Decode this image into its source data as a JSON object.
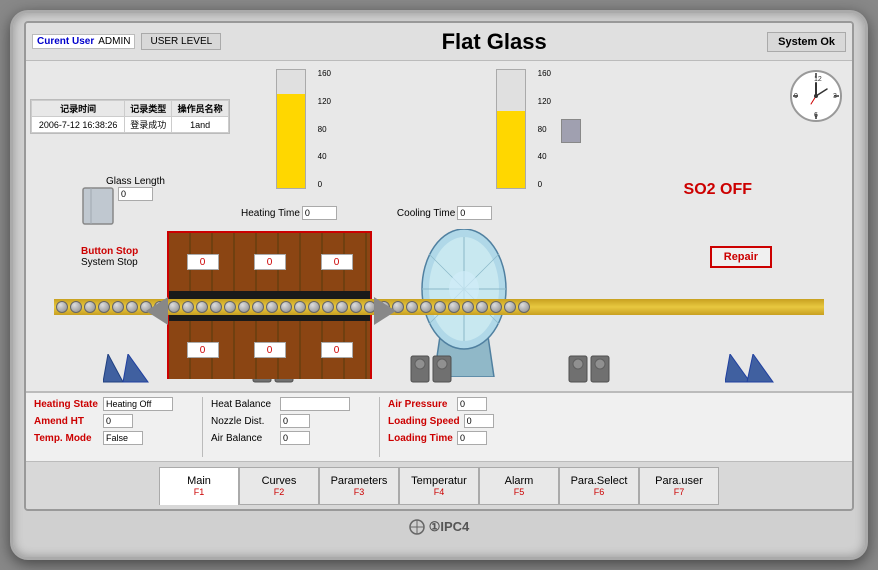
{
  "monitor": {
    "brand": "①IPC4"
  },
  "header": {
    "title": "Flat Glass",
    "current_user_label": "Curent User",
    "admin_value": "ADMIN",
    "user_level_btn": "USER LEVEL",
    "system_ok": "System Ok"
  },
  "log": {
    "headers": [
      "记录时间",
      "记录类型",
      "操作员名称"
    ],
    "rows": [
      [
        "2006-7-12 16:38:26",
        "登录成功",
        "1and"
      ]
    ]
  },
  "gauges": {
    "left_label": "",
    "right_label": "",
    "scale": [
      "160",
      "120",
      "80",
      "40",
      "0"
    ],
    "heating_time_label": "Heating Time",
    "heating_time_value": "0",
    "cooling_time_label": "Cooling Time",
    "cooling_time_value": "0"
  },
  "glass": {
    "length_label": "Glass Length",
    "length_value": "0"
  },
  "so2": {
    "label": "SO2 OFF"
  },
  "controls": {
    "button_stop_label": "Button Stop",
    "system_stop_label": "System Stop",
    "repair_btn": "Repair"
  },
  "furnace_values": {
    "top": [
      "0",
      "0",
      "0"
    ],
    "bottom": [
      "0",
      "0",
      "0"
    ]
  },
  "status": {
    "heating_state_label": "Heating State",
    "heating_state_value": "Heating Off",
    "amend_ht_label": "Amend HT",
    "amend_ht_value": "0",
    "temp_mode_label": "Temp. Mode",
    "temp_mode_value": "False",
    "heat_balance_label": "Heat Balance",
    "heat_balance_value": "",
    "nozzle_dist_label": "Nozzle Dist.",
    "nozzle_dist_value": "0",
    "air_balance_label": "Air Balance",
    "air_balance_value": "0",
    "air_pressure_label": "Air Pressure",
    "air_pressure_value": "0",
    "loading_speed_label": "Loading Speed",
    "loading_speed_value": "0",
    "loading_time_label": "Loading Time",
    "loading_time_value": "0"
  },
  "nav": {
    "buttons": [
      {
        "label": "Main",
        "sub": "F1"
      },
      {
        "label": "Curves",
        "sub": "F2"
      },
      {
        "label": "Parameters",
        "sub": "F3"
      },
      {
        "label": "Temperatur",
        "sub": "F4"
      },
      {
        "label": "Alarm",
        "sub": "F5"
      },
      {
        "label": "Para.Select",
        "sub": "F6"
      },
      {
        "label": "Para.user",
        "sub": "F7"
      }
    ]
  }
}
